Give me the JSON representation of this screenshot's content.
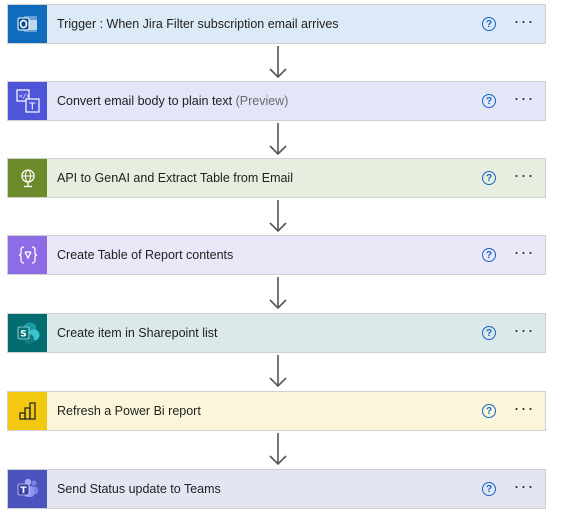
{
  "steps": [
    {
      "label": "Trigger : When Jira Filter subscription email arrives",
      "suffix": "",
      "icon": "outlook-icon",
      "bg": "#dce9f7",
      "iconbg": "#0f6cbd"
    },
    {
      "label": "Convert email body to plain text",
      "suffix": "(Preview)",
      "icon": "html-to-text-icon",
      "bg": "#e3e6f7",
      "iconbg": "#4f55d8"
    },
    {
      "label": "API to GenAI and Extract Table from Email",
      "suffix": "",
      "icon": "http-globe-icon",
      "bg": "#e7eedf",
      "iconbg": "#6b8a2a"
    },
    {
      "label": "Create Table of Report contents",
      "suffix": "",
      "icon": "data-operation-icon",
      "bg": "#ece6f9",
      "iconbg": "#8e6ce6"
    },
    {
      "label": "Create item in Sharepoint list",
      "suffix": "",
      "icon": "sharepoint-icon",
      "bg": "#dce9e9",
      "iconbg": "#036c70"
    },
    {
      "label": "Refresh a Power Bi report",
      "suffix": "",
      "icon": "power-bi-icon",
      "bg": "#fbf6d9",
      "iconbg": "#f2c811"
    },
    {
      "label": "Send Status update to Teams",
      "suffix": "",
      "icon": "teams-icon",
      "bg": "#e4e5f3",
      "iconbg": "#4b53bc"
    }
  ],
  "help_glyph": "?",
  "more_glyph": "···"
}
